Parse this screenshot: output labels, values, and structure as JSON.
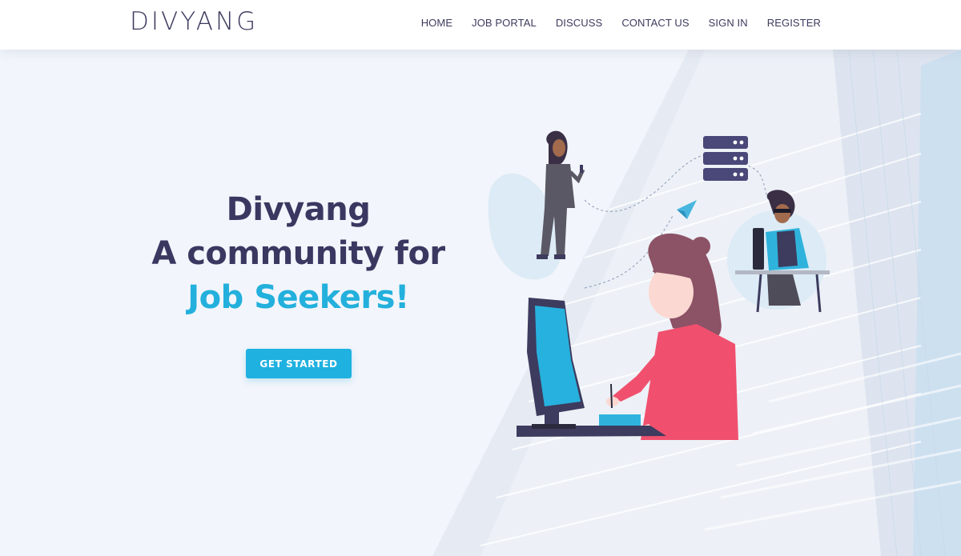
{
  "header": {
    "logo": "DIVYANG",
    "nav": [
      {
        "label": "HOME"
      },
      {
        "label": "JOB PORTAL"
      },
      {
        "label": "DISCUSS"
      },
      {
        "label": "CONTACT US"
      },
      {
        "label": "SIGN IN"
      },
      {
        "label": "REGISTER"
      }
    ]
  },
  "hero": {
    "line1": "Divyang",
    "line2": "A community for",
    "line3": "Job Seekers!",
    "cta_label": "GET STARTED"
  },
  "colors": {
    "brand_text": "#3a3861",
    "accent": "#1fb1e0",
    "background": "#f2f5fb",
    "header_bg": "#ffffff"
  },
  "icons": [
    "server-icon",
    "paper-plane-icon"
  ]
}
